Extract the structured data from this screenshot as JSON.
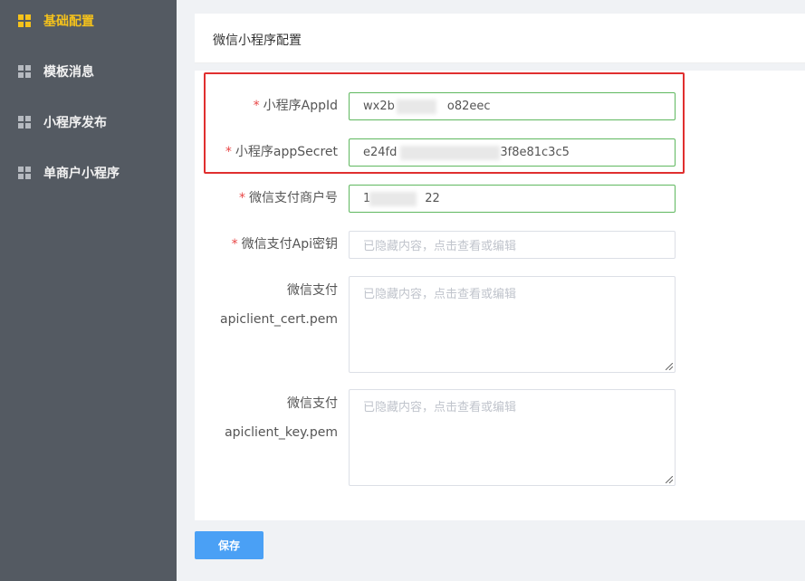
{
  "sidebar": {
    "items": [
      {
        "label": "基础配置",
        "icon": "grid-icon",
        "active": true
      },
      {
        "label": "模板消息",
        "icon": "grid-icon",
        "active": false
      },
      {
        "label": "小程序发布",
        "icon": "grid-icon",
        "active": false
      },
      {
        "label": "单商户小程序",
        "icon": "grid-icon",
        "active": false
      }
    ]
  },
  "header": {
    "title": "微信小程序配置"
  },
  "form": {
    "required_mark": "*",
    "appid": {
      "label": "小程序AppId",
      "value_start": "wx2b",
      "value_end": "o82eec"
    },
    "appsecret": {
      "label": "小程序appSecret",
      "value_start": "e24fd",
      "value_end": "3f8e81c3c5"
    },
    "mch_id": {
      "label": "微信支付商户号",
      "value_start": "1",
      "value_end": "22"
    },
    "api_key": {
      "label": "微信支付Api密钥",
      "placeholder": "已隐藏内容，点击查看或编辑"
    },
    "cert": {
      "label_line1": "微信支付",
      "label_line2": "apiclient_cert.pem",
      "placeholder": "已隐藏内容，点击查看或编辑"
    },
    "key": {
      "label_line1": "微信支付",
      "label_line2": "apiclient_key.pem",
      "placeholder": "已隐藏内容，点击查看或编辑"
    }
  },
  "actions": {
    "save_label": "保存"
  },
  "colors": {
    "sidebar_bg": "#545a62",
    "active_text": "#f5c21b",
    "highlight_border": "#e02f2f",
    "input_valid_border": "#5fb85f",
    "button_primary": "#4aa0f5"
  }
}
